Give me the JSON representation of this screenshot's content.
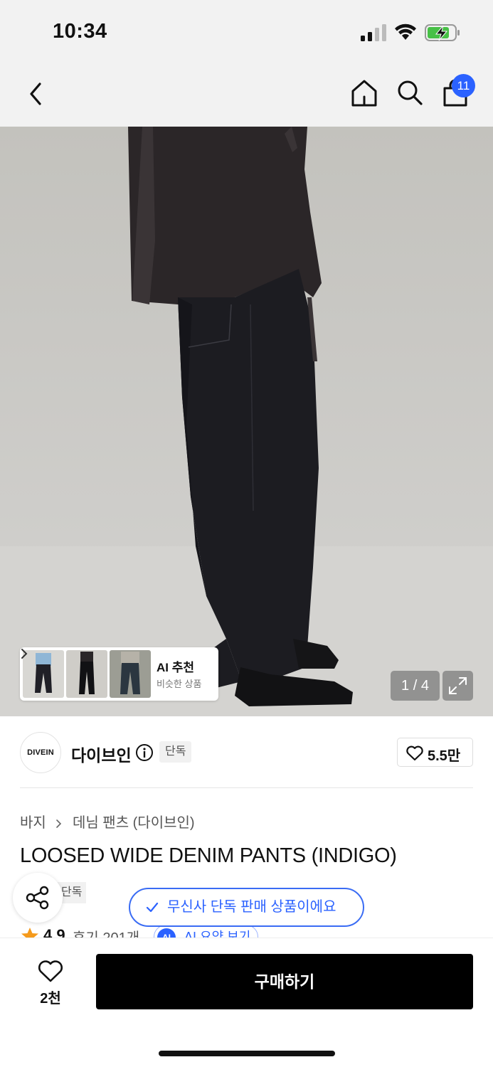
{
  "status_bar": {
    "time": "10:34"
  },
  "header": {
    "cart_badge": "11"
  },
  "gallery": {
    "counter": "1 / 4",
    "ai_recommend": {
      "title": "AI 추천",
      "subtitle": "비슷한 상품"
    }
  },
  "brand": {
    "logo_text": "DIVEIN",
    "name": "다이브인",
    "badge": "단독",
    "likes": "5.5만"
  },
  "breadcrumb": {
    "category": "바지",
    "subcategory": "데님 팬츠 (다이브인)"
  },
  "product": {
    "title": "LOOSED WIDE DENIM PANTS (INDIGO)",
    "exclusive_badge": "단독",
    "rating": "4.9",
    "reviews": "후기 201개",
    "ai_summary_icon": "AI",
    "ai_summary_label": "AI 요약 보기"
  },
  "toast": {
    "message": "무신사 단독 판매 상품이에요"
  },
  "bottom_bar": {
    "wish_count": "2천",
    "buy_label": "구매하기"
  },
  "colors": {
    "accent": "#2b62ff",
    "buy_button": "#000000",
    "rating_star": "#f59a1b"
  }
}
